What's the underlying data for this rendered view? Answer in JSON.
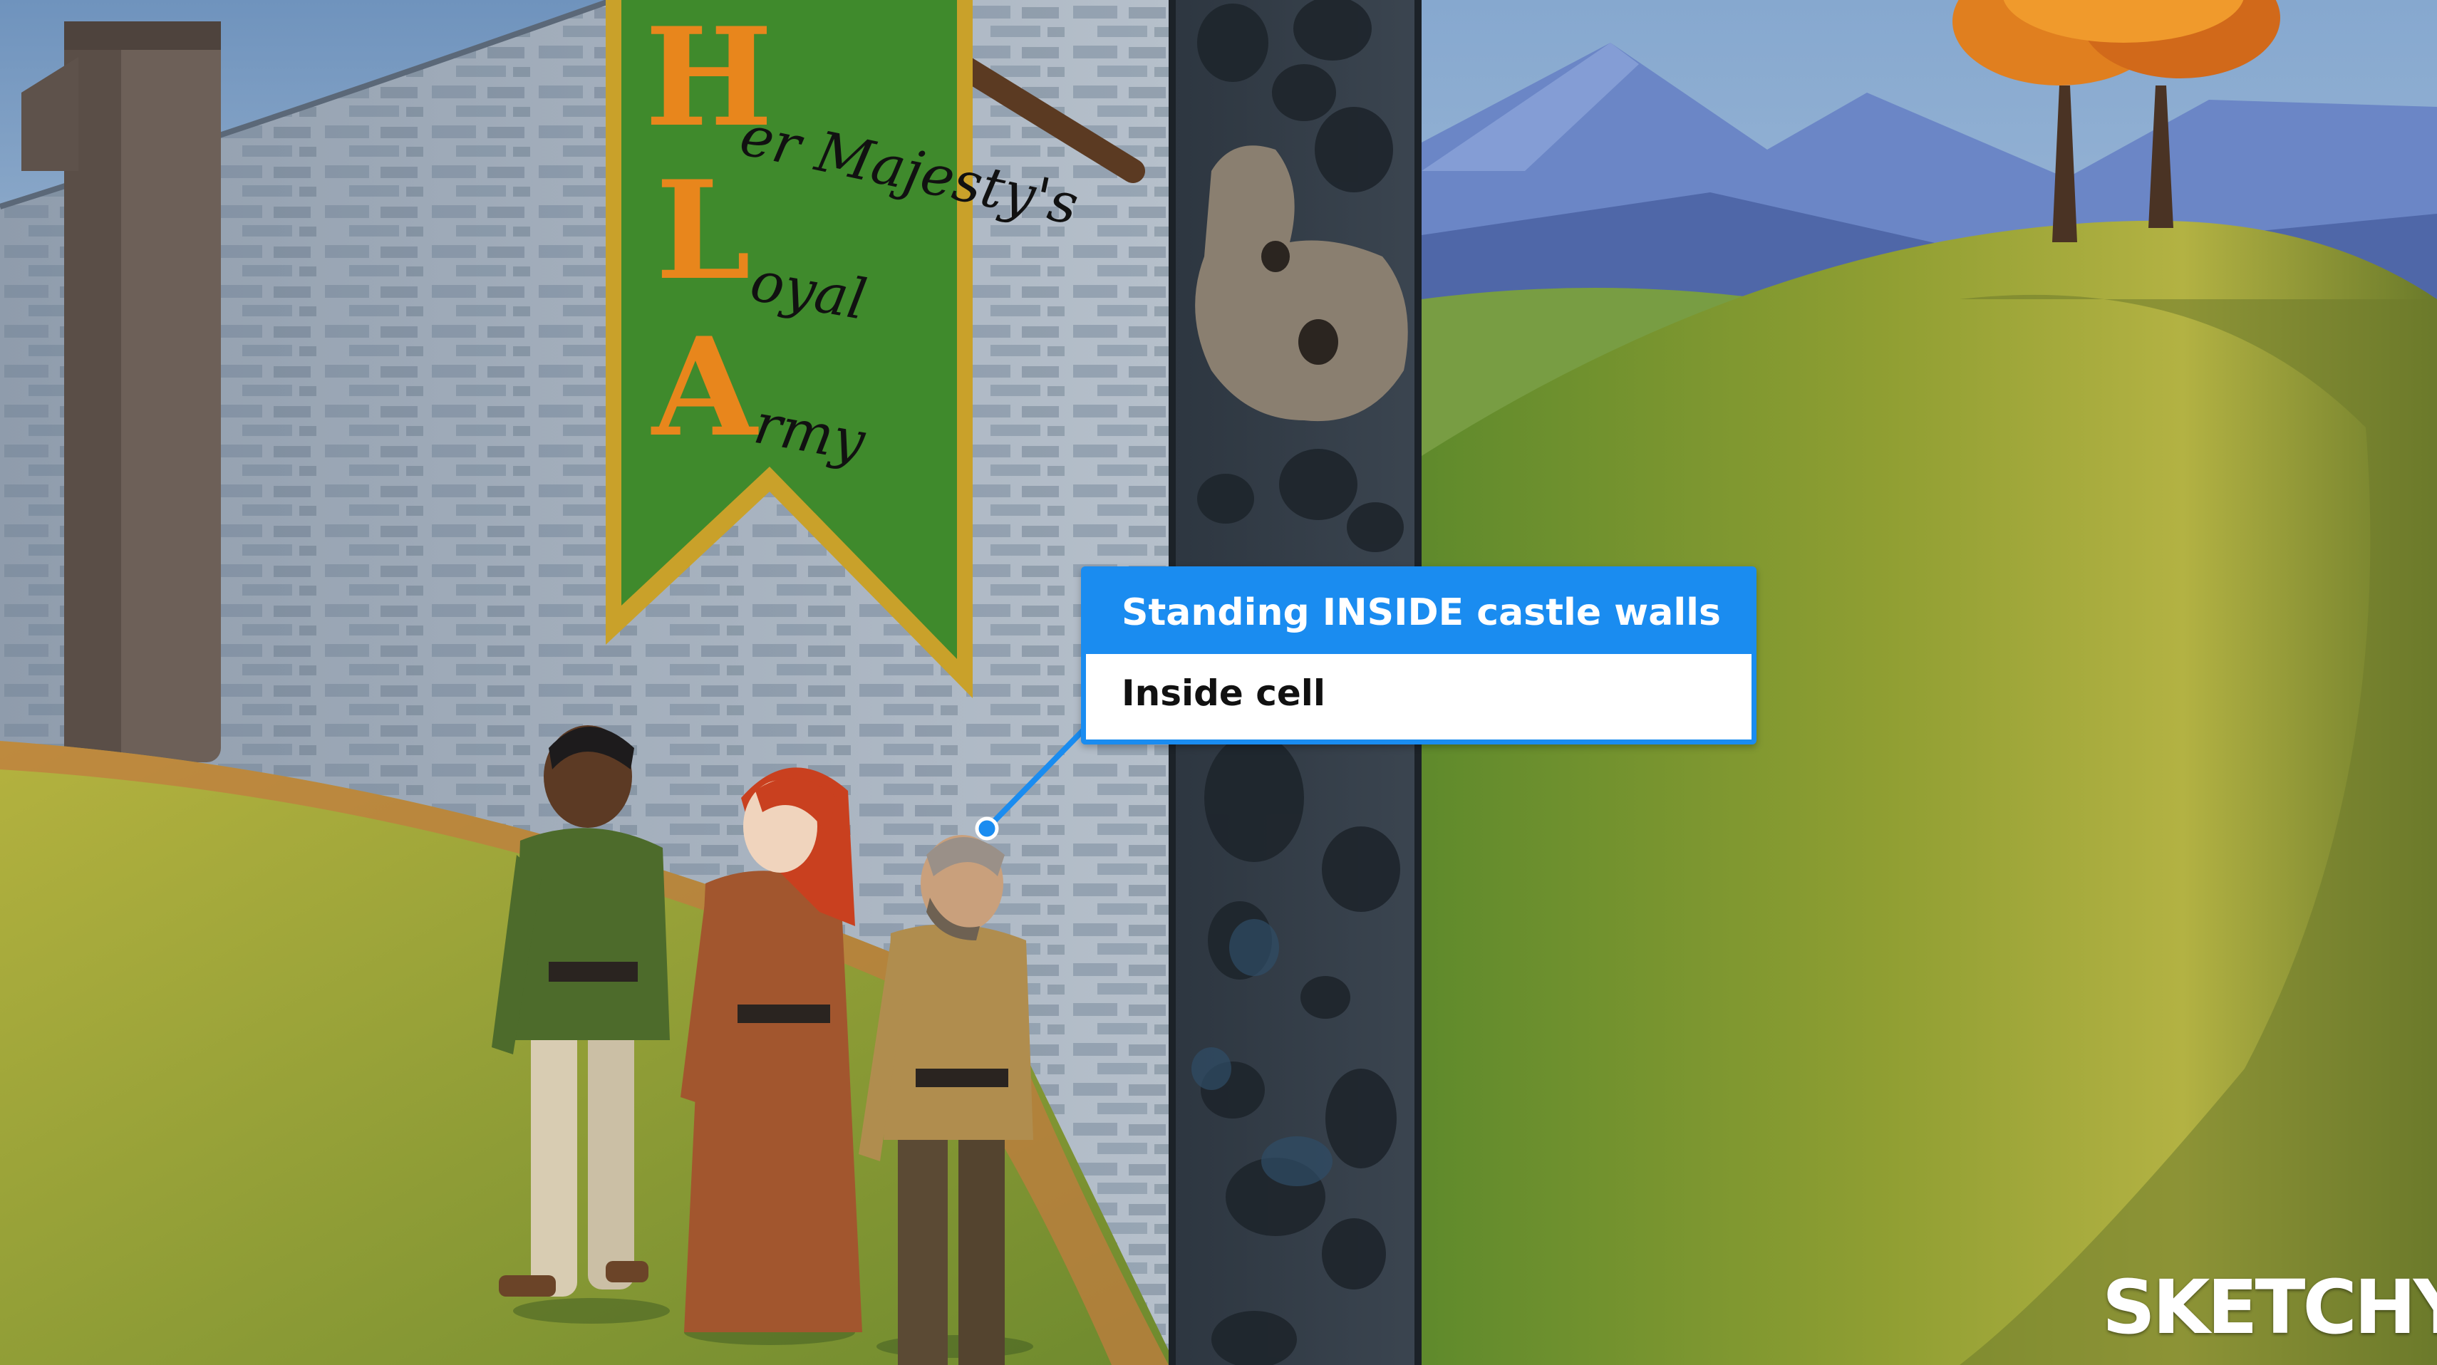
{
  "banner": {
    "initials": [
      "H",
      "L",
      "A"
    ],
    "words": [
      "er Majesty's",
      "oyal",
      "rmy"
    ],
    "cloth_color": "#3f8a2c",
    "trim_color": "#c9a12a",
    "letter_color": "#e8861c"
  },
  "callout": {
    "title": "Standing INSIDE castle walls",
    "subtitle": "Inside cell",
    "accent_color": "#1a8cf0"
  },
  "brand": {
    "logo_text": "SKETCHY"
  }
}
